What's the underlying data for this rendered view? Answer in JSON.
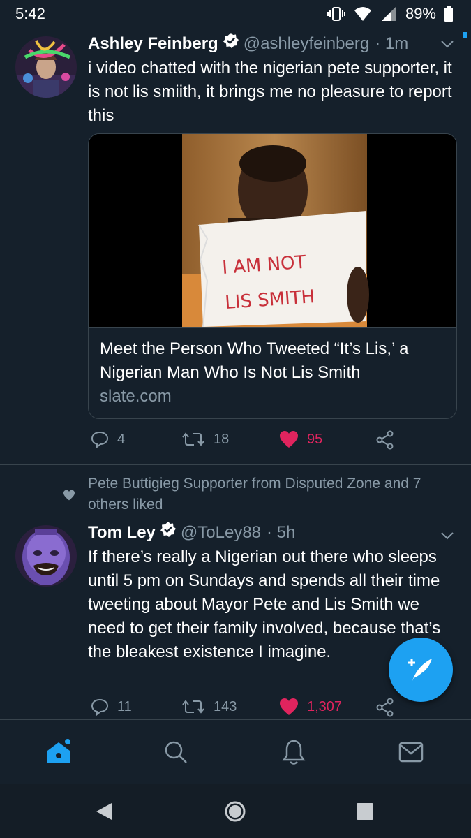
{
  "status_bar": {
    "time": "5:42",
    "battery": "89%"
  },
  "tweets": [
    {
      "name": "Ashley Feinberg",
      "handle": "@ashleyfeinberg",
      "time": "· 1m",
      "text": "i video chatted with the nigerian pete supporter, it is not lis smiith, it brings me no pleasure to report this",
      "card": {
        "sign_line1": "I AM NOT",
        "sign_line2": "LIS SMITH",
        "title": "Meet the Person Who Tweeted “It’s Lis,’ a Nigerian Man Who Is Not Lis Smith",
        "domain": "slate.com"
      },
      "replies": "4",
      "retweets": "18",
      "likes": "95"
    },
    {
      "context": "Pete Buttigieg Supporter from Disputed Zone and 7 others liked",
      "name": "Tom Ley",
      "handle": "@ToLey88",
      "time": "· 5h",
      "text": "If there’s really a Nigerian out there who sleeps until 5 pm on Sundays and spends all their time tweeting about Mayor Pete and Lis Smith we need to get their family involved, because that’s the bleakest existence I imagine.",
      "replies": "11",
      "retweets": "143",
      "likes": "1,307"
    }
  ],
  "colors": {
    "background": "#15202b",
    "accent": "#1da1f2",
    "like": "#e0245e",
    "secondary_text": "#8899a6",
    "divider": "#38444d"
  },
  "nav": {
    "items": [
      "home-icon",
      "search-icon",
      "notifications-icon",
      "messages-icon"
    ],
    "active": "home-icon"
  }
}
